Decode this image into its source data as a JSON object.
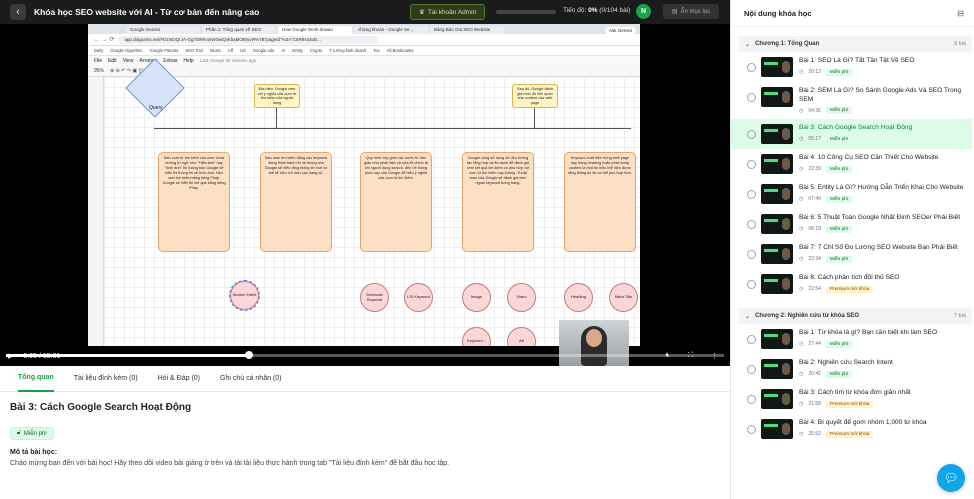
{
  "header": {
    "back_icon": "arrow-left-icon",
    "course_title": "Khóa học SEO website với AI - Từ cơ bản đến nâng cao",
    "admin_label": "Tài khoản Admin",
    "progress_label": "Tiến độ:",
    "progress_percent": "0%",
    "progress_count": "(0/104 bài)",
    "progress_fraction": 0,
    "avatar_initial": "N",
    "hide_menu_label": "Ẩn mục lục"
  },
  "video": {
    "browser": {
      "tabs": [
        "Google Gemini",
        "Phần 1: Tổng quan về SEO",
        "How Google Work.drawio",
        "chứng khoán - Google Se...",
        "Bảng Báo Giá SEO Website"
      ],
      "ask_label": "Ask Gemini",
      "url": "app.diagrams.net/#G1NOQrJA-Gg7SIRK4eWOwQvlrbaMOBIyvi#%7B\"pageId\"%3A\"C5R8s43oD...",
      "bookmarks": [
        "Daily",
        "Google Algorithm",
        "Google Patents",
        "SEO Tool",
        "Music",
        "Aff",
        "US",
        "Google Ads",
        "AI",
        "Entity",
        "Crypto",
        "Ý tưởng kinh doanh",
        "Tax",
        "All Bookmarks"
      ],
      "menu": [
        "File",
        "Edit",
        "View",
        "Arrange",
        "Extras",
        "Help"
      ],
      "menu_note": "Last change 28 minutes ago",
      "zoom": "95%"
    },
    "diagram": {
      "query": "Query",
      "yellow_left": "Đầu tiên, Google xem xét ý nghĩa của cụm từ tìm kiếm của người dùng",
      "yellow_right": "Sau đó, Google đánh giá mức độ liên quan của content của web page",
      "box1": "Nếu cụm từ tìm kiếm của user chứa những từ ngữ như \"Hiểu ảnh\" hay \"hình ảnh\" thì thông báo Google sẽ hiển thị thông tin về hình ảnh. Nếu user tìm kiếm bằng tiếng Pháp, Google sẽ hiển thị kết quả bằng tiếng Pháp.",
      "box2": "Nếu user tìm kiếm bằng các keyword đang thịnh hành thì hệ thống của Google sẽ hiểu rằng thông tin mới có thể sẽ hữu ích hơn các trang cũ.",
      "box3": "Quy trình này gồm các bước từ đơn giản như phát hiện và sửa lỗi chính tả khi người dùng search, đến hệ thống phức tạp của Google để hiểu ý nghĩa của cụm từ tìm kiếm.",
      "box4": "Google cũng sử dụng dữ liệu tương tác tổng hợp và ẩn danh để đánh giá xem kết quả tìm kiếm có phù hợp với cụm từ tìm kiếm hay không. Thuật toán của Google sẽ đánh giá xem ngoài keyword trong trang.",
      "box5": "Keyword xuất hiện trong web page hay trong heading hoặc phần body content là một tín hiệu thể hiện được rằng thông tin đó có thể phù hợp hơn.",
      "circles": [
        "Search Intent",
        "Semantic Keyword",
        "LSI Keyword",
        "Image",
        "Video",
        "Heading",
        "Meta Title",
        "Keyword...",
        "Alt"
      ]
    },
    "controls": {
      "play_icon": "play-icon",
      "current_time": "5:05",
      "duration": "15:01",
      "time_separator": " / ",
      "watched_fraction": 0.338,
      "mute_icon": "volume-muted-icon",
      "fullscreen_icon": "fullscreen-icon",
      "more_icon": "more-vertical-icon"
    }
  },
  "tabs": [
    "Tổng quan",
    "Tài liệu đính kèm (0)",
    "Hỏi & Đáp (0)",
    "Ghi chú cá nhân (0)"
  ],
  "lesson": {
    "title": "Bài 3: Cách Google Search Hoạt Động",
    "badge": "Miễn phí",
    "desc_title": "Mô tả bài học:",
    "desc": "Chào mừng bạn đến với bài học! Hãy theo dõi video bài giảng ở trên và tải tài liệu thực hành trong tab \"Tài liệu đính kèm\" để bắt đầu học tập."
  },
  "sidebar": {
    "title": "Nội dung khóa học",
    "sections": [
      {
        "title": "Chương 1: Tổng Quan",
        "count": "8 bài",
        "items": [
          {
            "title": "Bài 1: SEO Là Gì? Tất Tần Tật Về SEO",
            "duration": "20:12",
            "tag": "Miễn phí",
            "premium": false
          },
          {
            "title": "Bài 2: SEM Là Gì? So Sánh Google Ads Và SEO Trong SEM",
            "duration": "04:36",
            "tag": "Miễn phí",
            "premium": false
          },
          {
            "title": "Bài 3: Cách Google Search Hoạt Động",
            "duration": "05:17",
            "tag": "Miễn phí",
            "premium": false
          },
          {
            "title": "Bài 4: 10 Công Cụ SEO Cần Thiết Cho Website",
            "duration": "22:39",
            "tag": "Miễn phí",
            "premium": false
          },
          {
            "title": "Bài 5: Entity Là Gì? Hướng Dẫn Triển Khai Cho Website",
            "duration": "07:49",
            "tag": "Miễn phí",
            "premium": false
          },
          {
            "title": "Bài 6: 5 Thuật Toán Google Nhất Định SEOer Phải Biết",
            "duration": "08:18",
            "tag": "Miễn phí",
            "premium": false
          },
          {
            "title": "Bài 7: 7 Chỉ Số Đo Lường SEO Website Bạn Phải Biết",
            "duration": "22:34",
            "tag": "Miễn phí",
            "premium": false
          },
          {
            "title": "Bài 8: Cách phân tích đối thủ SEO",
            "duration": "22:54",
            "tag": "Premium mở khóa",
            "premium": true
          }
        ]
      },
      {
        "title": "Chương 2: Nghiên cứu từ khóa SEO",
        "count": "7 bài",
        "items": [
          {
            "title": "Bài 1: Từ khóa là gì? Bạn cần biết khi làm SEO",
            "duration": "27:44",
            "tag": "Miễn phí",
            "premium": false
          },
          {
            "title": "Bài 2: Nghiên cứu Search Intent",
            "duration": "20:42",
            "tag": "Miễn phí",
            "premium": false
          },
          {
            "title": "Bài 3: Cách tìm từ khóa đơn giản nhất",
            "duration": "21:58",
            "tag": "Premium mở khóa",
            "premium": true
          },
          {
            "title": "Bài 4: Bí quyết để gom nhóm 1,000 từ khóa",
            "duration": "25:52",
            "tag": "Premium mở khóa",
            "premium": true
          }
        ]
      }
    ],
    "active_section": 0,
    "active_item": 2
  },
  "colors": {
    "accent": "#16a34a",
    "active_bg": "#dcfce7",
    "premium_bg": "#fef3c7"
  }
}
